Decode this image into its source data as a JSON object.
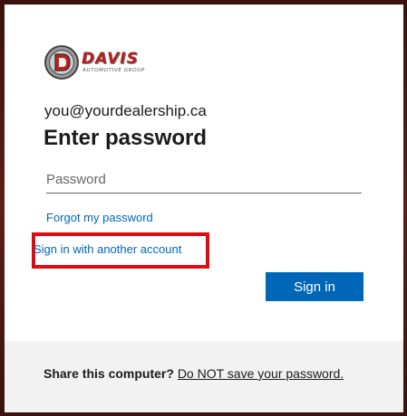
{
  "logo": {
    "name": "DAVIS",
    "tagline": "AUTOMOTIVE GROUP",
    "brand_color": "#b3201d",
    "icon": "davis-d-emblem"
  },
  "account": {
    "email": "you@yourdealership.ca"
  },
  "form": {
    "title": "Enter password",
    "password_placeholder": "Password",
    "password_value": ""
  },
  "links": {
    "forgot_password": "Forgot my password",
    "sign_in_another": "Sign in with another account"
  },
  "buttons": {
    "sign_in": "Sign in"
  },
  "footer": {
    "question": "Share this computer?",
    "link": "Do NOT save your password."
  },
  "colors": {
    "accent": "#0067b8",
    "highlight_box": "#e00b10",
    "footer_bg": "#f2f2f2",
    "page_bg": "#4a1a14"
  }
}
